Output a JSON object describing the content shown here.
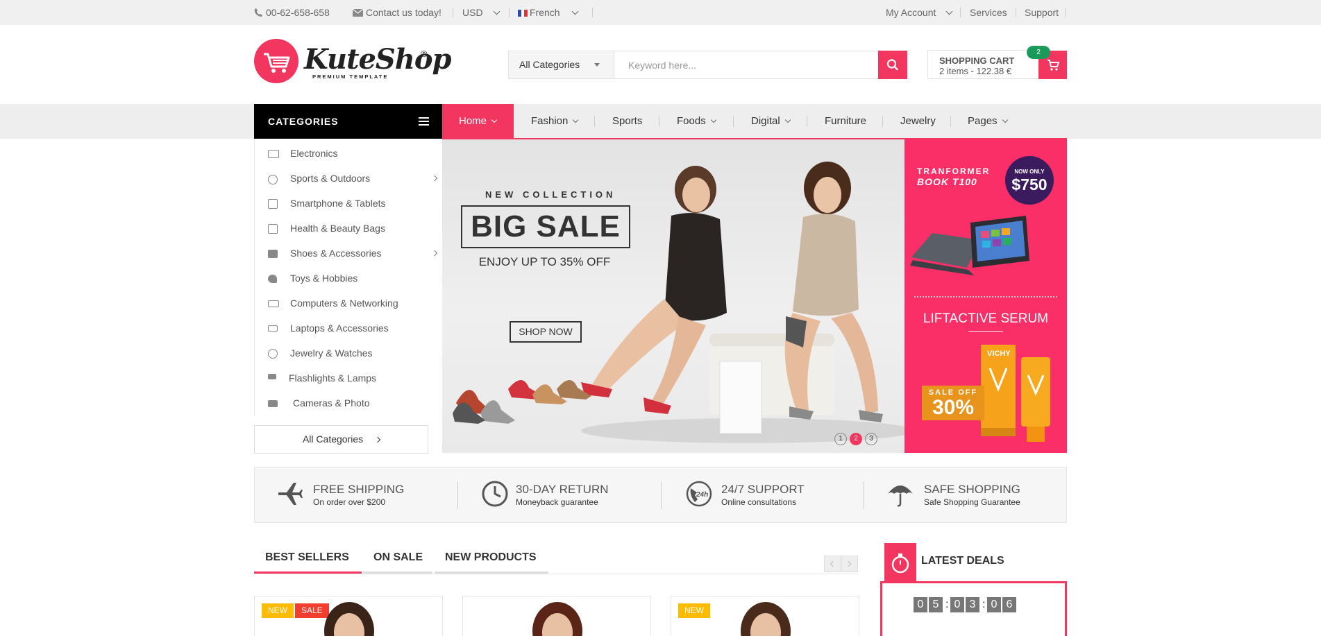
{
  "topbar": {
    "phone": "00-62-658-658",
    "contact": "Contact us today!",
    "currency": "USD",
    "language": "French",
    "my_account": "My Account",
    "services": "Services",
    "support": "Support"
  },
  "header": {
    "logo_text": "KuteShop",
    "logo_reg": "®",
    "logo_sub": "PREMIUM TEMPLATE",
    "search_category": "All Categories",
    "search_placeholder": "Keyword here...",
    "cart_title": "SHOPPING CART",
    "cart_info": "2 items - 122.38 €",
    "cart_count": "2"
  },
  "nav": {
    "categories_label": "CATEGORIES",
    "items": [
      "Home",
      "Fashion",
      "Sports",
      "Foods",
      "Digital",
      "Furniture",
      "Jewelry",
      "Pages"
    ]
  },
  "sidebar": {
    "items": [
      {
        "label": "Electronics",
        "icon": "tv-icon"
      },
      {
        "label": "Sports & Outdoors",
        "icon": "bicycle-icon"
      },
      {
        "label": "Smartphone & Tablets",
        "icon": "phone-icon"
      },
      {
        "label": "Health & Beauty Bags",
        "icon": "health-icon"
      },
      {
        "label": "Shoes & Accessories",
        "icon": "bag-icon"
      },
      {
        "label": "Toys & Hobbies",
        "icon": "toy-icon"
      },
      {
        "label": "Computers & Networking",
        "icon": "computer-icon"
      },
      {
        "label": "Laptops & Accessories",
        "icon": "laptop-icon"
      },
      {
        "label": "Jewelry & Watches",
        "icon": "ring-icon"
      },
      {
        "label": "Flashlights & Lamps",
        "icon": "lamp-icon"
      },
      {
        "label": "Cameras & Photo",
        "icon": "camera-icon"
      }
    ],
    "all_categories": "All Categories"
  },
  "slider": {
    "kicker": "NEW COLLECTION",
    "headline": "BIG SALE",
    "subline": "ENJOY UP TO 35% OFF",
    "button": "SHOP NOW",
    "dots": [
      "1",
      "2",
      "3"
    ],
    "active_dot": 2
  },
  "right_banner": {
    "line1": "TRANFORMER",
    "line2": "BOOK T100",
    "now_only": "NOW ONLY",
    "price": "$750",
    "serum": "LIFTACTIVE SERUM",
    "sale_off": "SALE OFF",
    "sale_pct": "30%",
    "brand": "VICHY"
  },
  "features": [
    {
      "title": "FREE SHIPPING",
      "sub": "On order over $200",
      "icon": "plane-icon"
    },
    {
      "title": "30-DAY RETURN",
      "sub": "Moneyback guarantee",
      "icon": "clock-icon"
    },
    {
      "title": "24/7 SUPPORT",
      "sub": "Online consultations",
      "icon": "support-icon"
    },
    {
      "title": "SAFE SHOPPING",
      "sub": "Safe Shopping Guarantee",
      "icon": "umbrella-icon"
    }
  ],
  "tabs": [
    "BEST SELLERS",
    "ON SALE",
    "NEW PRODUCTS"
  ],
  "badges": {
    "new": "NEW",
    "sale": "SALE"
  },
  "deals": {
    "title": "LATEST DEALS",
    "digits": [
      "0",
      "5",
      "0",
      "3",
      "0",
      "6"
    ]
  },
  "colors": {
    "accent": "#f2365f",
    "banner_pink": "#fa2f68",
    "badge_green": "#1b9a5a",
    "badge_new": "#ffbb00",
    "badge_sale": "#f23e2e"
  }
}
